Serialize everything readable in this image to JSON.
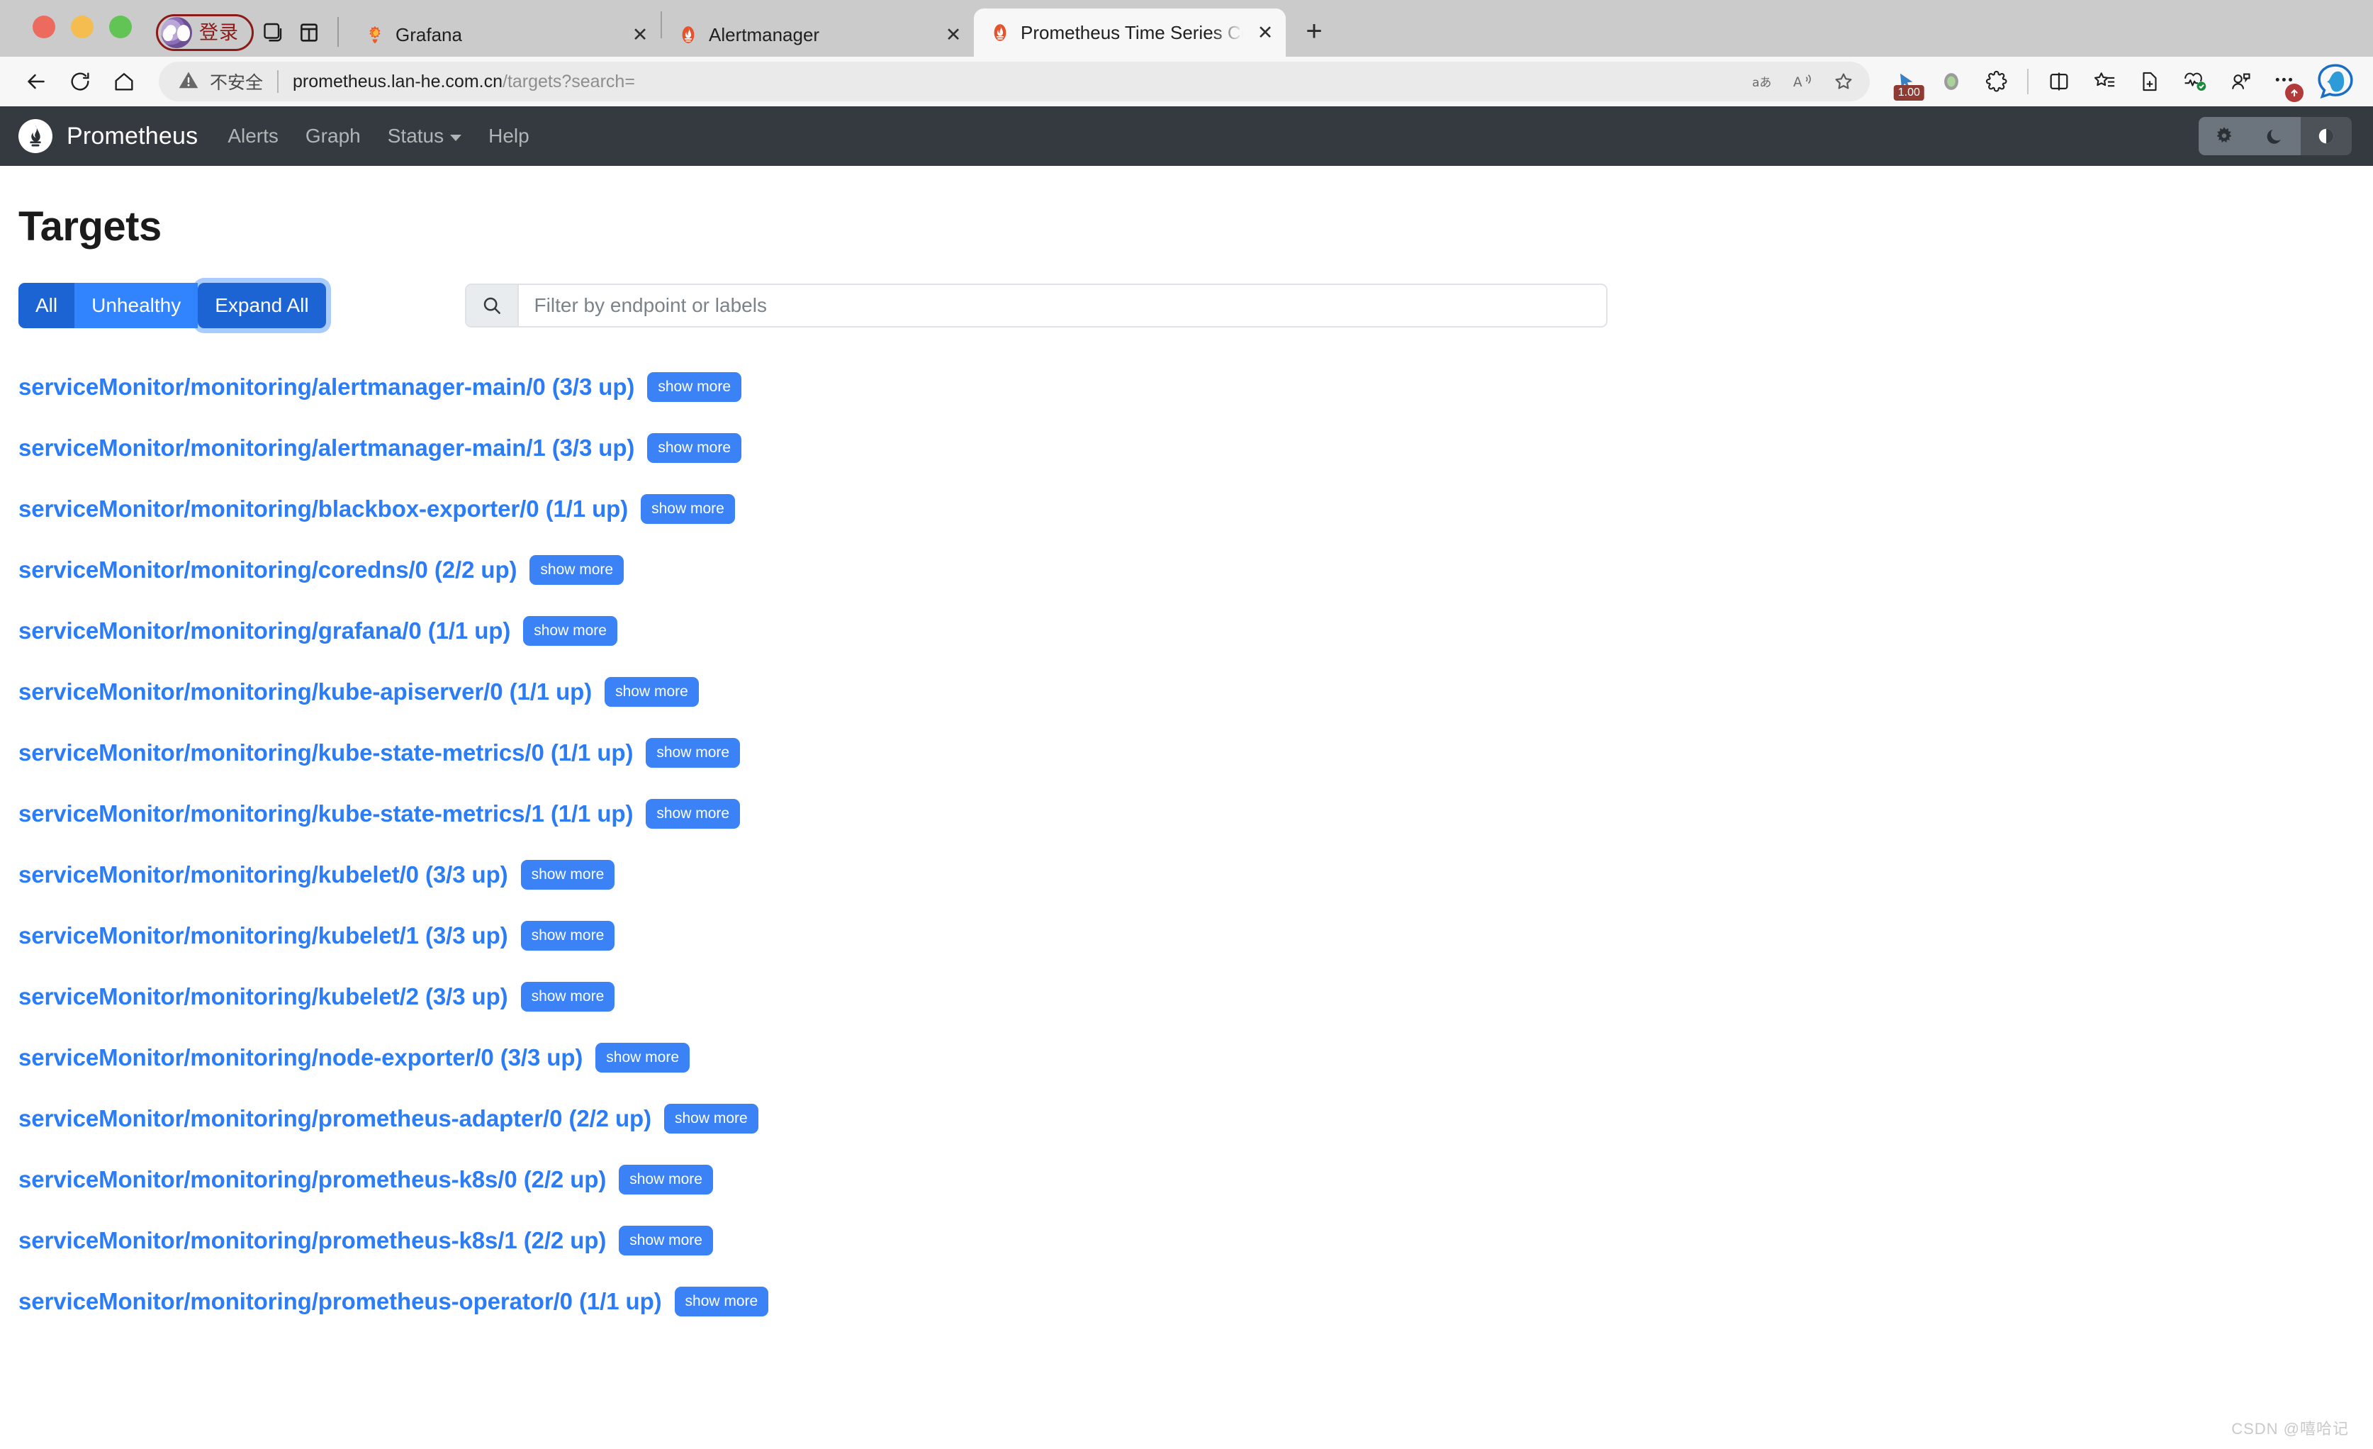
{
  "browser": {
    "window_controls": [
      "close",
      "minimize",
      "maximize"
    ],
    "profile": {
      "label": "登录",
      "icon": "avatar-icon"
    },
    "chrome_icons": [
      "tab-group-icon",
      "split-screen-icon"
    ],
    "tabs": [
      {
        "title": "Grafana",
        "favicon": "grafana-icon",
        "active": false
      },
      {
        "title": "Alertmanager",
        "favicon": "prometheus-icon",
        "active": false
      },
      {
        "title": "Prometheus Time Series Collect",
        "favicon": "prometheus-icon",
        "active": true
      }
    ],
    "new_tab_label": "+",
    "nav": {
      "back": "back-arrow-icon",
      "reload": "reload-icon",
      "home": "home-icon"
    },
    "omnibox": {
      "security_label": "不安全",
      "url_host": "prometheus.lan-he.com.cn",
      "url_path": "/targets?search=",
      "inline_icons": [
        "translate-icon",
        "read-aloud-icon",
        "favorite-star-icon"
      ]
    },
    "toolbar_right": {
      "zoom_badge": "1.00",
      "icons": [
        "cursor-zoom-icon",
        "mute-tab-icon",
        "extensions-icon",
        "split-screen-icon",
        "collections-icon",
        "add-to-collection-icon",
        "browser-essentials-icon",
        "profile-settings-icon",
        "more-options-icon",
        "copilot-icon"
      ]
    }
  },
  "prometheus": {
    "brand": "Prometheus",
    "logo_icon": "prometheus-logo-icon",
    "nav_items": [
      {
        "label": "Alerts",
        "has_caret": false
      },
      {
        "label": "Graph",
        "has_caret": false
      },
      {
        "label": "Status",
        "has_caret": true
      },
      {
        "label": "Help",
        "has_caret": false
      }
    ],
    "theme_buttons": [
      {
        "name": "light-theme",
        "icon": "sun-icon",
        "active": false
      },
      {
        "name": "dark-theme",
        "icon": "moon-icon",
        "active": false
      },
      {
        "name": "auto-theme",
        "icon": "contrast-icon",
        "active": true
      }
    ]
  },
  "page": {
    "title": "Targets",
    "filters": [
      {
        "label": "All",
        "state": "active"
      },
      {
        "label": "Unhealthy",
        "state": "inactive"
      },
      {
        "label": "Expand All",
        "state": "focused"
      }
    ],
    "search": {
      "placeholder": "Filter by endpoint or labels",
      "value": "",
      "icon": "search-icon"
    },
    "show_more_label": "show more",
    "targets": [
      {
        "name": "serviceMonitor/monitoring/alertmanager-main/0",
        "status": "(3/3 up)"
      },
      {
        "name": "serviceMonitor/monitoring/alertmanager-main/1",
        "status": "(3/3 up)"
      },
      {
        "name": "serviceMonitor/monitoring/blackbox-exporter/0",
        "status": "(1/1 up)"
      },
      {
        "name": "serviceMonitor/monitoring/coredns/0",
        "status": "(2/2 up)"
      },
      {
        "name": "serviceMonitor/monitoring/grafana/0",
        "status": "(1/1 up)"
      },
      {
        "name": "serviceMonitor/monitoring/kube-apiserver/0",
        "status": "(1/1 up)"
      },
      {
        "name": "serviceMonitor/monitoring/kube-state-metrics/0",
        "status": "(1/1 up)"
      },
      {
        "name": "serviceMonitor/monitoring/kube-state-metrics/1",
        "status": "(1/1 up)"
      },
      {
        "name": "serviceMonitor/monitoring/kubelet/0",
        "status": "(3/3 up)"
      },
      {
        "name": "serviceMonitor/monitoring/kubelet/1",
        "status": "(3/3 up)"
      },
      {
        "name": "serviceMonitor/monitoring/kubelet/2",
        "status": "(3/3 up)"
      },
      {
        "name": "serviceMonitor/monitoring/node-exporter/0",
        "status": "(3/3 up)"
      },
      {
        "name": "serviceMonitor/monitoring/prometheus-adapter/0",
        "status": "(2/2 up)"
      },
      {
        "name": "serviceMonitor/monitoring/prometheus-k8s/0",
        "status": "(2/2 up)"
      },
      {
        "name": "serviceMonitor/monitoring/prometheus-k8s/1",
        "status": "(2/2 up)"
      },
      {
        "name": "serviceMonitor/monitoring/prometheus-operator/0",
        "status": "(1/1 up)"
      }
    ],
    "watermark": "CSDN @嘻哈记"
  },
  "colors": {
    "navbar_bg": "#343a40",
    "link_blue": "#2b7cf5",
    "button_blue": "#3b82f6",
    "active_filter": "#1c64d4",
    "inactive_filter": "#3184fd"
  }
}
